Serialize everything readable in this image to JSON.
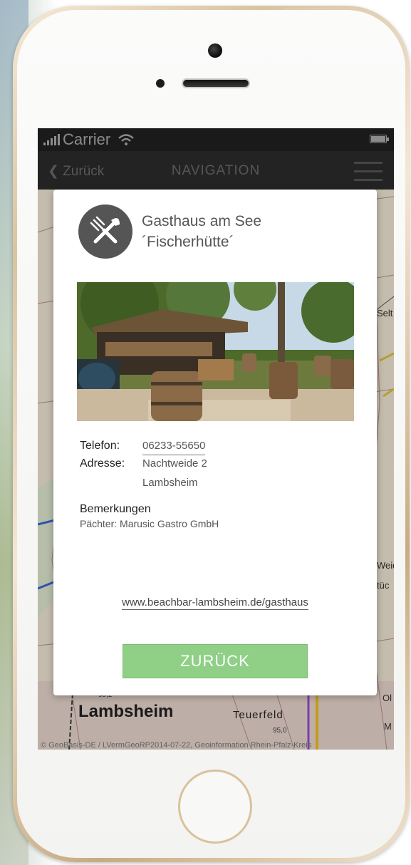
{
  "status_bar": {
    "carrier": "Carrier"
  },
  "nav_bar": {
    "back_label": "Zurück",
    "title": "NAVIGATION"
  },
  "map": {
    "town_label": "Lambsheim",
    "field_label": "Teuerfeld",
    "elevation_1": "95,2",
    "elevation_2": "95,0",
    "edge_labels": [
      "Selt",
      "Weid",
      "tüc",
      "Ol",
      "M"
    ],
    "credit": "© GeoBasis-DE / LVermGeoRP2014-07-22, Geoinformation Rhein-Pfalz-Kreis"
  },
  "poi": {
    "icon": "fork-knife-icon",
    "name_line1": "Gasthaus am See",
    "name_line2": "´Fischerhütte´",
    "phone_label": "Telefon:",
    "phone_value": "06233-55650",
    "address_label": "Adresse:",
    "address_line1": "Nachtweide 2",
    "address_line2": "Lambsheim",
    "remarks_title": "Bemerkungen",
    "remarks_text": "Pächter: Marusic Gastro GmbH",
    "website": "www.beachbar-lambsheim.de/gasthaus",
    "back_button": "ZURÜCK"
  },
  "colors": {
    "button_green": "#8fcf86",
    "nav_bar": "#2b2b2b",
    "status_bar": "#202020",
    "icon_circle": "#555555"
  }
}
